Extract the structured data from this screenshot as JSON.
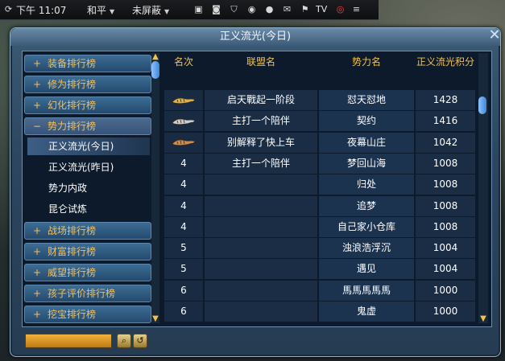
{
  "topbar": {
    "time": "下午 11:07",
    "mode": "和平",
    "block": "未屏蔽",
    "tv_label": "TV"
  },
  "window": {
    "title": "正义流光(今日)"
  },
  "sidebar": {
    "categories": [
      {
        "label": "装备排行榜",
        "symbol": "+"
      },
      {
        "label": "修为排行榜",
        "symbol": "+"
      },
      {
        "label": "幻化排行榜",
        "symbol": "+"
      },
      {
        "label": "势力排行榜",
        "symbol": "−"
      },
      {
        "label": "战场排行榜",
        "symbol": "+"
      },
      {
        "label": "财富排行榜",
        "symbol": "+"
      },
      {
        "label": "威望排行榜",
        "symbol": "+"
      },
      {
        "label": "孩子评价排行榜",
        "symbol": "+"
      },
      {
        "label": "挖宝排行榜",
        "symbol": "+"
      }
    ],
    "subitems": [
      {
        "label": "正义流光(今日)",
        "selected": true
      },
      {
        "label": "正义流光(昨日)",
        "selected": false
      },
      {
        "label": "势力内政",
        "selected": false
      },
      {
        "label": "昆仑试炼",
        "selected": false
      }
    ]
  },
  "table": {
    "headers": [
      "名次",
      "联盟名",
      "势力名",
      "正义流光积分"
    ],
    "rows": [
      {
        "rank": "",
        "rank_icon": "tiger-gold",
        "alliance": "启天戰起一阶段",
        "force": "怼天怼地",
        "score": "1428"
      },
      {
        "rank": "",
        "rank_icon": "tiger-silver",
        "alliance": "主打一个陪伴",
        "force": "契约",
        "score": "1416"
      },
      {
        "rank": "",
        "rank_icon": "tiger-bronze",
        "alliance": "别解释了快上车",
        "force": "夜幕山庄",
        "score": "1042"
      },
      {
        "rank": "4",
        "rank_icon": "",
        "alliance": "主打一个陪伴",
        "force": "梦回山海",
        "score": "1008"
      },
      {
        "rank": "4",
        "rank_icon": "",
        "alliance": "",
        "force": "归处",
        "score": "1008"
      },
      {
        "rank": "4",
        "rank_icon": "",
        "alliance": "",
        "force": "追梦",
        "score": "1008"
      },
      {
        "rank": "4",
        "rank_icon": "",
        "alliance": "",
        "force": "自己家小仓库",
        "score": "1008"
      },
      {
        "rank": "5",
        "rank_icon": "",
        "alliance": "",
        "force": "浊浪浩浮沉",
        "score": "1004"
      },
      {
        "rank": "5",
        "rank_icon": "",
        "alliance": "",
        "force": "遇见",
        "score": "1004"
      },
      {
        "rank": "6",
        "rank_icon": "",
        "alliance": "",
        "force": "馬馬馬馬馬",
        "score": "1000"
      },
      {
        "rank": "6",
        "rank_icon": "",
        "alliance": "",
        "force": "鬼虚",
        "score": "1000"
      }
    ]
  },
  "colors": {
    "header_gold": "#f2c24a",
    "category_text": "#f0c060",
    "panel_blue": "#2c4660"
  }
}
